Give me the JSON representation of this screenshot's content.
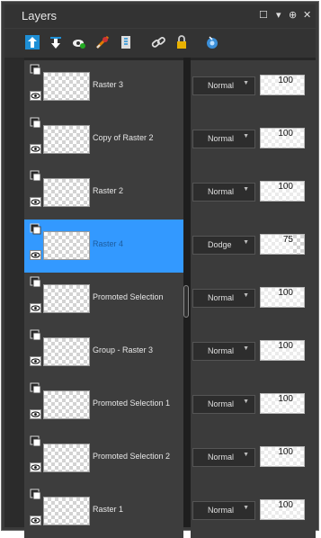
{
  "panel": {
    "title": "Layers",
    "controls": {
      "restore": "☐",
      "menu": "▾",
      "pin": "⊕",
      "close": "✕"
    }
  },
  "toolbar": {
    "icons": [
      "move-layer-up-icon",
      "move-layer-down-icon",
      "new-layer-icon",
      "delete-layer-icon",
      "properties-icon",
      "link-icon",
      "lock-icon",
      "visibility-icon"
    ]
  },
  "layers": [
    {
      "name": "Raster 3",
      "blend": "Normal",
      "opacity": "100",
      "opacity_value": 100,
      "selected": false
    },
    {
      "name": "Copy of Raster 2",
      "blend": "Normal",
      "opacity": "100",
      "opacity_value": 100,
      "selected": false
    },
    {
      "name": "Raster 2",
      "blend": "Normal",
      "opacity": "100",
      "opacity_value": 100,
      "selected": false
    },
    {
      "name": "Raster 4",
      "blend": "Dodge",
      "opacity": "75",
      "opacity_value": 75,
      "selected": true
    },
    {
      "name": "Promoted Selection",
      "blend": "Normal",
      "opacity": "100",
      "opacity_value": 100,
      "selected": false
    },
    {
      "name": "Group - Raster 3",
      "blend": "Normal",
      "opacity": "100",
      "opacity_value": 100,
      "selected": false
    },
    {
      "name": "Promoted Selection 1",
      "blend": "Normal",
      "opacity": "100",
      "opacity_value": 100,
      "selected": false
    },
    {
      "name": "Promoted Selection 2",
      "blend": "Normal",
      "opacity": "100",
      "opacity_value": 100,
      "selected": false
    },
    {
      "name": "Raster 1",
      "blend": "Normal",
      "opacity": "100",
      "opacity_value": 100,
      "selected": false
    }
  ],
  "colors": {
    "selected": "#3399ff",
    "panel": "#3b3b3b"
  }
}
